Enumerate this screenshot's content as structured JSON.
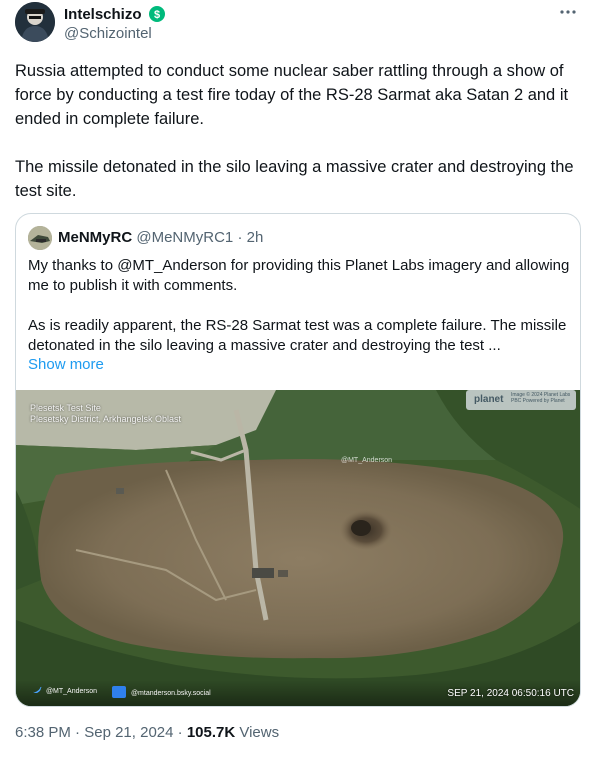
{
  "author": {
    "name": "Intelschizo",
    "handle": "@Schizointel",
    "verified_icon": "verified-badge-icon",
    "verified_color": "#00ba7c"
  },
  "more_icon": "more-horizontal-icon",
  "tweet": {
    "paragraphs": [
      "Russia attempted to conduct some nuclear saber rattling through a show of force by conducting a test fire today of the RS-28 Sarmat aka Satan 2 and it ended in complete failure.",
      "The missile detonated in the silo leaving a massive crater and destroying the test site."
    ]
  },
  "quote": {
    "name": "MeNMyRC",
    "handle": "@MeNMyRC1",
    "separator": "·",
    "time": "2h",
    "paragraphs": [
      "My thanks to @MT_Anderson for providing this Planet Labs imagery and allowing me to publish it with comments.",
      "As is readily apparent, the RS-28 Sarmat test was a complete failure.  The missile detonated in the silo leaving a massive crater and destroying the test ..."
    ],
    "show_more": "Show more",
    "image": {
      "site_title": "Plesetsk Test Site",
      "site_subtitle": "Plesetsky District, Arkhangelsk Oblast",
      "watermark": "@MT_Anderson",
      "planet_logo": "planet",
      "planet_copyright": "Image © 2024 Planet Labs PBC Powered by Planet",
      "credit_twitter": "@MT_Anderson",
      "credit_bluesky": "@mtanderson.bsky.social",
      "capture_date": "SEP 21, 2024 06:50:16 UTC"
    }
  },
  "meta": {
    "time": "6:38 PM",
    "dot1": "·",
    "date": "Sep 21, 2024",
    "dot2": "·",
    "views_count": "105.7K",
    "views_label": "Views"
  },
  "colors": {
    "link": "#1d9bf0",
    "secondary_text": "#536471",
    "border": "#cfd9de"
  }
}
